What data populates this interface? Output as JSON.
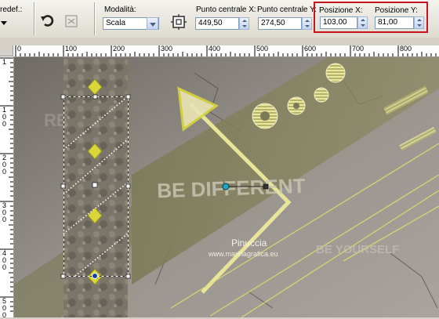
{
  "toolbar": {
    "preset_label": "redef.:",
    "mode_label": "Modalità:",
    "mode_value": "Scala",
    "center_x_label": "Punto centrale X:",
    "center_x_value": "449,50",
    "center_y_label": "Punto centrale Y:",
    "center_y_value": "274,50",
    "pos_x_label": "Posizione X:",
    "pos_x_value": "103,00",
    "pos_y_label": "Posizione Y:",
    "pos_y_value": "81,00",
    "highlight_color": "#c8141e"
  },
  "ruler_top": {
    "labels": [
      "0",
      "100",
      "200",
      "300",
      "400",
      "500",
      "600",
      "700",
      "800"
    ]
  },
  "ruler_left": {
    "labels": [
      "1",
      "100",
      "200",
      "300",
      "400",
      "500"
    ]
  },
  "canvas": {
    "big_text": "BE DIFFERENT",
    "side_text": "BE YOURSELF",
    "left_text": "RE",
    "watermark_name": "Pinuccia",
    "watermark_url": "www.marinagrafica.eu"
  },
  "colors": {
    "accent_yellow": "#d9d63a",
    "canvas_base": "#8f8a84"
  }
}
